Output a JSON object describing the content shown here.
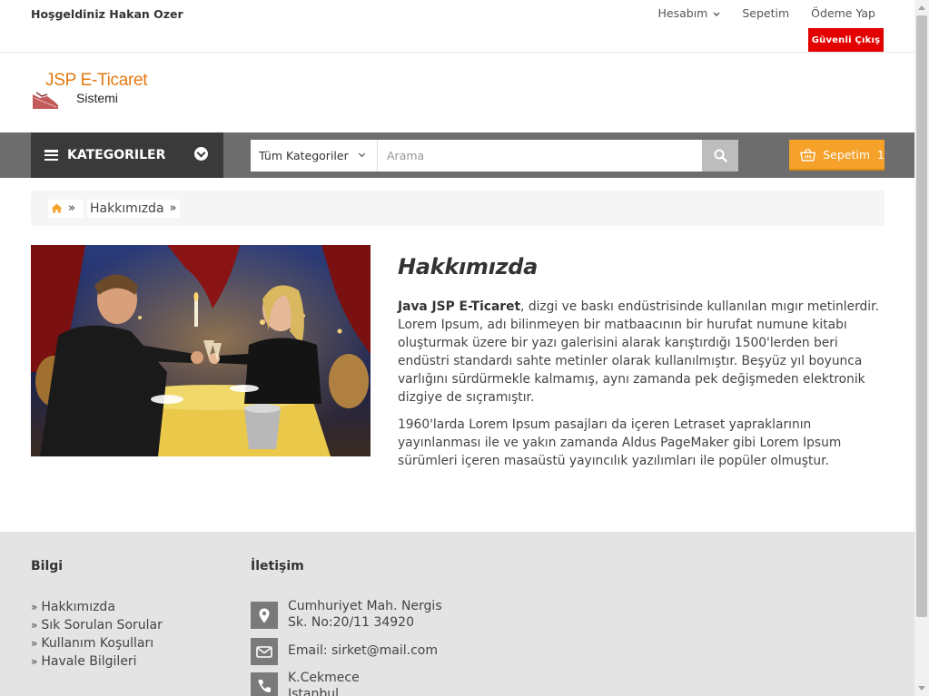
{
  "topbar": {
    "welcome": "Hoşgeldiniz Hakan Ozer",
    "account_label": "Hesabım",
    "cart_link": "Sepetim",
    "checkout_link": "Ödeme Yap",
    "logout_label": "Güvenli Çıkış"
  },
  "logo": {
    "title": "JSP E-Ticaret",
    "subtitle": "Sistemi"
  },
  "nav": {
    "categories_label": "KATEGORILER",
    "search_category": "Tüm Kategoriler",
    "search_placeholder": "Arama",
    "cart_label": "Sepetim",
    "cart_count": "1"
  },
  "breadcrumb": {
    "current": "Hakkımızda"
  },
  "about": {
    "title": "Hakkımızda",
    "brand": "Java JSP E-Ticaret",
    "paragraph1_rest": ", dizgi ve baskı endüstrisinde kullanılan mıgır metinlerdir. Lorem Ipsum, adı bilinmeyen bir matbaacının bir hurufat numune kitabı oluşturmak üzere bir yazı galerisini alarak karıştırdığı 1500'lerden beri endüstri standardı sahte metinler olarak kullanılmıştır. Beşyüz yıl boyunca varlığını sürdürmekle kalmamış, aynı zamanda pek değişmeden elektronik dizgiye de sıçramıştır.",
    "paragraph2": "1960'larda Lorem Ipsum pasajları da içeren Letraset yapraklarının yayınlanması ile ve yakın zamanda Aldus PageMaker gibi Lorem Ipsum sürümleri içeren masaüstü yayıncılık yazılımları ile popüler olmuştur."
  },
  "footer": {
    "info_heading": "Bilgi",
    "info_links": [
      "Hakkımızda",
      "Sık Sorulan Sorular",
      "Kullanım Koşulları",
      "Havale Bilgileri"
    ],
    "contact_heading": "İletişim",
    "address_line1": "Cumhuriyet Mah. Nergis",
    "address_line2": "Sk. No:20/11 34920",
    "email": "Email: sirket@mail.com",
    "phone_line1": "K.Cekmece",
    "phone_line2": "Istanbul"
  },
  "colors": {
    "accent_orange": "#f5a12a",
    "logout_red": "#e30000",
    "nav_gray": "#6d6d6d",
    "category_dark": "#3a3a3a"
  },
  "icons": [
    "chevron-down-icon",
    "hamburger-icon",
    "search-icon",
    "basket-icon",
    "home-icon",
    "map-marker-icon",
    "envelope-icon",
    "phone-icon"
  ]
}
